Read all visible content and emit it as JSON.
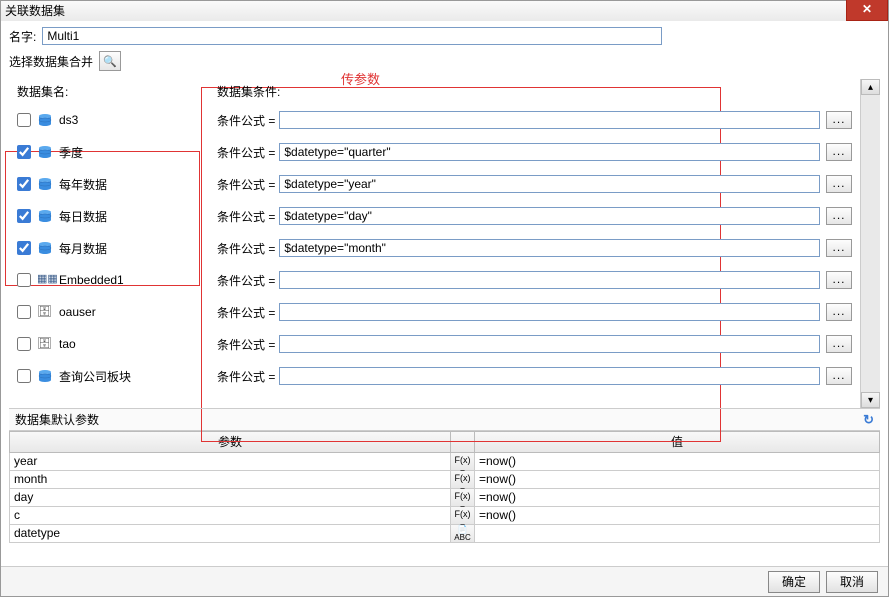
{
  "window": {
    "title": "关联数据集"
  },
  "header": {
    "name_label": "名字:",
    "name_value": "Multi1",
    "merge_label": "选择数据集合并",
    "annotation": "传参数"
  },
  "columns": {
    "dataset_name_label": "数据集名:",
    "condition_label": "数据集条件:"
  },
  "datasets": [
    {
      "label": "ds3",
      "checked": false,
      "icon": "db"
    },
    {
      "label": "季度",
      "checked": true,
      "icon": "db"
    },
    {
      "label": "每年数据",
      "checked": true,
      "icon": "db"
    },
    {
      "label": "每日数据",
      "checked": true,
      "icon": "db"
    },
    {
      "label": "每月数据",
      "checked": true,
      "icon": "db"
    },
    {
      "label": "Embedded1",
      "checked": false,
      "icon": "tbl"
    },
    {
      "label": "oauser",
      "checked": false,
      "icon": "svr"
    },
    {
      "label": "tao",
      "checked": false,
      "icon": "svr"
    },
    {
      "label": "查询公司板块",
      "checked": false,
      "icon": "db"
    }
  ],
  "conditions": {
    "row_label": "条件公式 =",
    "values": [
      "",
      "$datetype=\"quarter\"",
      "$datetype=\"year\"",
      "$datetype=\"day\"",
      "$datetype=\"month\"",
      "",
      "",
      "",
      ""
    ],
    "more_label": "..."
  },
  "params": {
    "panel_label": "数据集默认参数",
    "header_param": "参数",
    "header_value": "值",
    "rows": [
      {
        "name": "year",
        "fx": "F(x)",
        "value": "=now()"
      },
      {
        "name": "month",
        "fx": "F(x)",
        "value": "=now()"
      },
      {
        "name": "day",
        "fx": "F(x)",
        "value": "=now()"
      },
      {
        "name": "c",
        "fx": "F(x)",
        "value": "=now()"
      },
      {
        "name": "datetype",
        "fx": "ABC",
        "value": ""
      }
    ]
  },
  "footer": {
    "ok": "确定",
    "cancel": "取消"
  }
}
